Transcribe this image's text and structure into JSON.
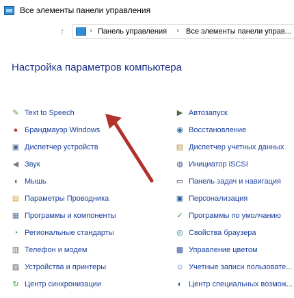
{
  "window": {
    "title": "Все элементы панели управления"
  },
  "nav": {
    "up_glyph": "↑",
    "address": {
      "sep": "›",
      "crumbs": [
        "Панель управления",
        "Все элементы панели управ..."
      ]
    }
  },
  "page": {
    "title": "Настройка параметров компьютера"
  },
  "left_items": [
    {
      "label": "Text to Speech",
      "icon": "speech-icon",
      "glyph": "✎",
      "color": "#6a8a3a"
    },
    {
      "label": "Брандмауэр Windows",
      "icon": "firewall-icon",
      "glyph": "●",
      "color": "#c0392b"
    },
    {
      "label": "Диспетчер устройств",
      "icon": "device-manager-icon",
      "glyph": "▣",
      "color": "#4a6a8a"
    },
    {
      "label": "Звук",
      "icon": "sound-icon",
      "glyph": "◀",
      "color": "#7a7a7a"
    },
    {
      "label": "Мышь",
      "icon": "mouse-icon",
      "glyph": "◖",
      "color": "#555555"
    },
    {
      "label": "Параметры Проводника",
      "icon": "explorer-options-icon",
      "glyph": "▤",
      "color": "#d9a33a"
    },
    {
      "label": "Программы и компоненты",
      "icon": "programs-icon",
      "glyph": "▦",
      "color": "#5a7a9a"
    },
    {
      "label": "Региональные стандарты",
      "icon": "region-icon",
      "glyph": "◔",
      "color": "#3a7a5a"
    },
    {
      "label": "Телефон и модем",
      "icon": "phone-modem-icon",
      "glyph": "▥",
      "color": "#6a6a6a"
    },
    {
      "label": "Устройства и принтеры",
      "icon": "printers-icon",
      "glyph": "▨",
      "color": "#4a5a6a"
    },
    {
      "label": "Центр синхронизации",
      "icon": "sync-center-icon",
      "glyph": "↻",
      "color": "#2a9a3a"
    }
  ],
  "right_items": [
    {
      "label": "Автозапуск",
      "icon": "autoplay-icon",
      "glyph": "▶",
      "color": "#4a6a4a"
    },
    {
      "label": "Восстановление",
      "icon": "recovery-icon",
      "glyph": "◉",
      "color": "#2a6aa0"
    },
    {
      "label": "Диспетчер учетных данных",
      "icon": "credential-manager-icon",
      "glyph": "▤",
      "color": "#b58a3a"
    },
    {
      "label": "Инициатор iSCSI",
      "icon": "iscsi-icon",
      "glyph": "◍",
      "color": "#3a5a8a"
    },
    {
      "label": "Панель задач и навигация",
      "icon": "taskbar-icon",
      "glyph": "▭",
      "color": "#4a4a6a"
    },
    {
      "label": "Персонализация",
      "icon": "personalization-icon",
      "glyph": "▣",
      "color": "#2a5a9a"
    },
    {
      "label": "Программы по умолчанию",
      "icon": "default-programs-icon",
      "glyph": "✓",
      "color": "#2a8a3a"
    },
    {
      "label": "Свойства браузера",
      "icon": "browser-properties-icon",
      "glyph": "◎",
      "color": "#2a7a9a"
    },
    {
      "label": "Управление цветом",
      "icon": "color-management-icon",
      "glyph": "▩",
      "color": "#3a5aa0"
    },
    {
      "label": "Учетные записи пользовате...",
      "icon": "user-accounts-icon",
      "glyph": "☺",
      "color": "#3a6aa0"
    },
    {
      "label": "Центр специальных возмож...",
      "icon": "ease-of-access-icon",
      "glyph": "◐",
      "color": "#2a5a9a"
    }
  ],
  "annotation": {
    "color": "#b0322a"
  }
}
